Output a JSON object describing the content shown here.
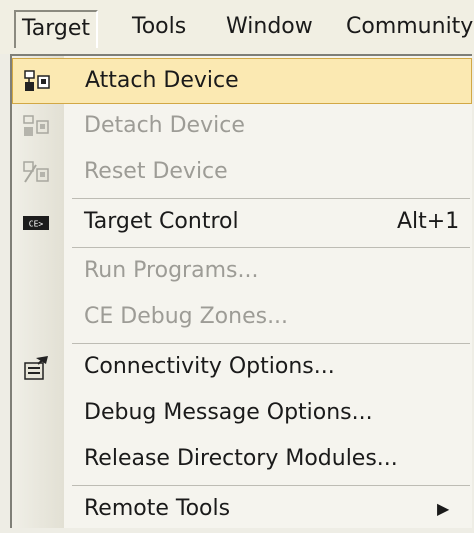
{
  "menubar": {
    "items": [
      {
        "label": "Target"
      },
      {
        "label": "Tools"
      },
      {
        "label": "Window"
      },
      {
        "label": "Community"
      }
    ]
  },
  "menu": {
    "items": [
      {
        "label": "Attach Device",
        "shortcut": "",
        "icon": "attach-device-icon",
        "enabled": true,
        "highlighted": true
      },
      {
        "label": "Detach Device",
        "shortcut": "",
        "icon": "detach-device-icon",
        "enabled": false
      },
      {
        "label": "Reset Device",
        "shortcut": "",
        "icon": "reset-device-icon",
        "enabled": false
      },
      {
        "label": "Target Control",
        "shortcut": "Alt+1",
        "icon": "target-control-icon",
        "enabled": true
      },
      {
        "label": "Run Programs...",
        "shortcut": "",
        "enabled": false
      },
      {
        "label": "CE Debug Zones...",
        "shortcut": "",
        "enabled": false
      },
      {
        "label": "Connectivity Options...",
        "shortcut": "",
        "icon": "connectivity-options-icon",
        "enabled": true
      },
      {
        "label": "Debug Message Options...",
        "shortcut": "",
        "enabled": true
      },
      {
        "label": "Release Directory Modules...",
        "shortcut": "",
        "enabled": true
      },
      {
        "label": "Remote Tools",
        "shortcut": "",
        "submenu": true,
        "enabled": true
      }
    ]
  },
  "colors": {
    "highlight_bg": "#fbe9b2",
    "highlight_border": "#d2a845",
    "disabled_text": "#9d9c96"
  }
}
